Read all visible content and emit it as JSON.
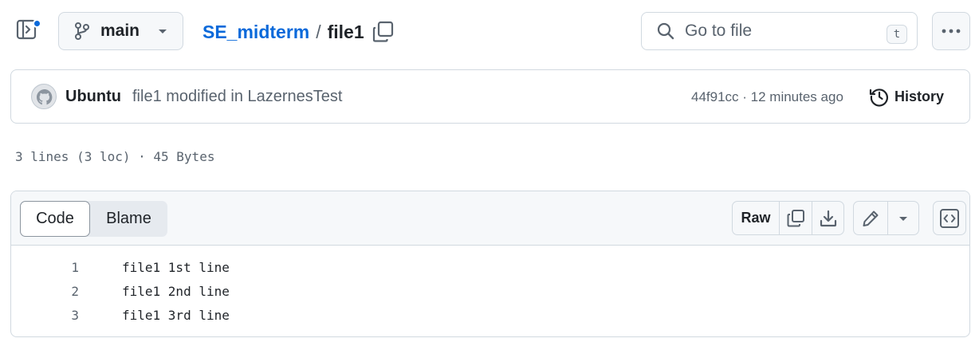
{
  "header": {
    "branch": "main",
    "repo": "SE_midterm",
    "separator": "/",
    "file": "file1",
    "search_placeholder": "Go to file",
    "search_shortcut": "t"
  },
  "commit": {
    "author": "Ubuntu",
    "message": "file1 modified in LazernesTest",
    "meta": "44f91cc · 12 minutes ago",
    "history_label": "History"
  },
  "file_info": "3 lines (3 loc) · 45 Bytes",
  "viewer": {
    "tabs": [
      "Code",
      "Blame"
    ],
    "raw_label": "Raw"
  },
  "lines": [
    {
      "num": "1",
      "text": "file1 1st line"
    },
    {
      "num": "2",
      "text": "file1 2nd line"
    },
    {
      "num": "3",
      "text": "file1 3rd line"
    }
  ],
  "colors": {
    "link": "#0969da",
    "notification_dot": "#0969da",
    "border": "#d1d9e0",
    "muted_text": "#59636e"
  }
}
